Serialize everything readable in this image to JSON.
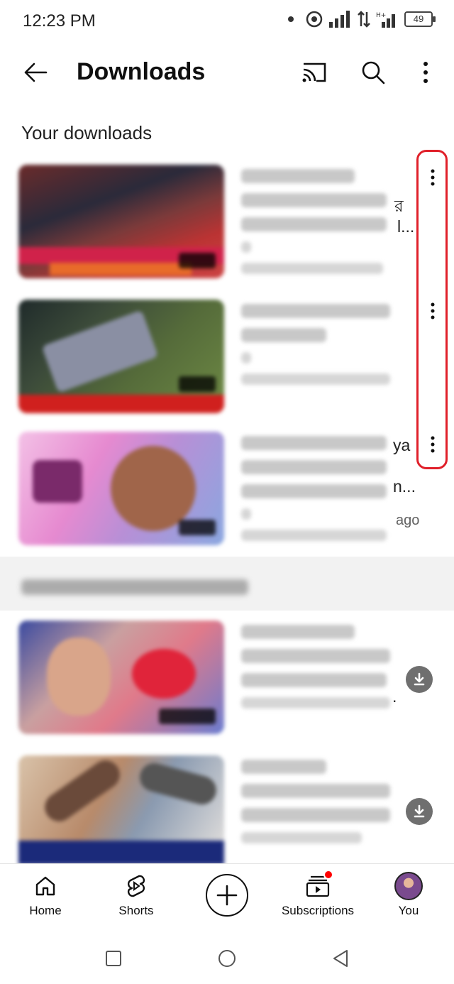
{
  "status_bar": {
    "time": "12:23 PM",
    "battery": "49",
    "icons": [
      "dot-icon",
      "hotspot-icon",
      "signal-icon",
      "data-arrows-icon",
      "signal-h-plus-icon",
      "battery-icon"
    ]
  },
  "app_bar": {
    "title": "Downloads",
    "icons": [
      "back-arrow-icon",
      "cast-icon",
      "search-icon",
      "more-vert-icon"
    ]
  },
  "downloads": {
    "heading": "Your downloads",
    "items": [
      {
        "title_visible_fragment": "র",
        "meta_visible_fragment": "l..."
      },
      {
        "title_visible_fragment": "",
        "meta_visible_fragment": ""
      },
      {
        "title_visible_fragment": "ya",
        "meta_visible_fragment": "n...",
        "age_visible_fragment": "ago"
      }
    ]
  },
  "recommended": {
    "items": [
      {
        "trail": "."
      },
      {
        "trail": ""
      }
    ]
  },
  "bottom_nav": {
    "home": "Home",
    "shorts": "Shorts",
    "subscriptions": "Subscriptions",
    "you": "You"
  },
  "colors": {
    "highlight": "#e0202a",
    "notification_dot": "#ff0000",
    "download_button": "#6f6f6f"
  }
}
